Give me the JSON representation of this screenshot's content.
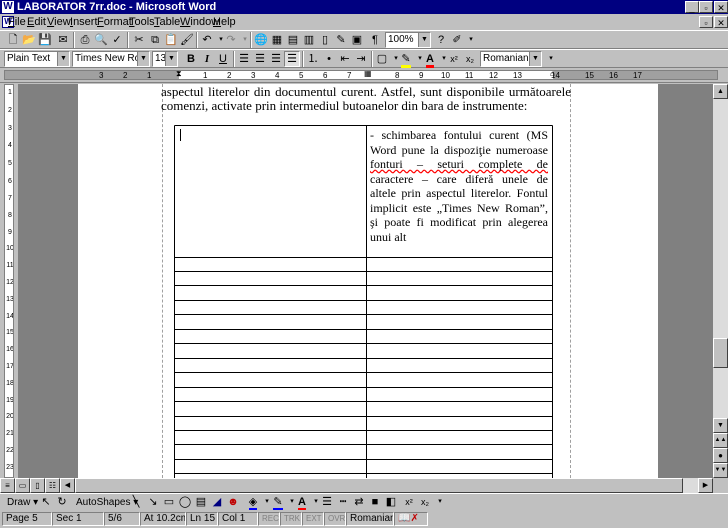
{
  "window": {
    "title": "LABORATOR 7rr.doc - Microsoft Word",
    "app_icon": "W",
    "buttons": {
      "minimize": "_",
      "restore": "▫",
      "close": "✕"
    }
  },
  "menu": {
    "items": [
      "File",
      "Edit",
      "View",
      "Insert",
      "Format",
      "Tools",
      "Table",
      "Window",
      "Help"
    ],
    "restore_icon": "▫",
    "close_icon": "✕"
  },
  "standard_toolbar": {
    "zoom": "100%"
  },
  "formatting_toolbar": {
    "style": "Plain Text",
    "font": "Times New Roman",
    "size": "13",
    "language": "Romanian (Rom"
  },
  "ruler": {
    "numbers": [
      "3",
      "2",
      "1",
      "1",
      "2",
      "3",
      "4",
      "5",
      "6",
      "7",
      "8",
      "9",
      "10",
      "11",
      "12",
      "13",
      "14",
      "15",
      "16",
      "17"
    ]
  },
  "vruler": {
    "numbers": [
      "1",
      "2",
      "3",
      "4",
      "5",
      "6",
      "7",
      "8",
      "9",
      "10",
      "11",
      "12",
      "13",
      "14",
      "15",
      "16",
      "17",
      "18",
      "19",
      "20",
      "21",
      "22",
      "23"
    ]
  },
  "document": {
    "lines": [
      "aspectul literelor din documentul curent. Astfel, sunt disponibile următoarele",
      "comenzi, activate prin intermediul butoanelor din bara de instrumente:"
    ],
    "table_cell_lines": [
      "- schimbarea fontului curent (MS",
      "Word pune la dispoziţie numeroase",
      "fonturi – seturi complete de",
      "caractere – care diferă unele de",
      "altele prin aspectul literelor. Fontul",
      "implicit este „Times New Roman”,",
      "şi poate fi modificat prin alegerea",
      "unui alt"
    ]
  },
  "draw_toolbar": {
    "draw_label": "Draw",
    "autoshapes_label": "AutoShapes"
  },
  "status": {
    "page": "Page 5",
    "section": "Sec 1",
    "pages": "5/6",
    "at": "At 10.2cm",
    "line": "Ln 15",
    "col": "Col 1",
    "rec": "REC",
    "trk": "TRK",
    "ext": "EXT",
    "ovr": "OVR",
    "language": "Romanian ("
  },
  "colors": {
    "title_bar": "#000080",
    "chrome": "#c0c0c0",
    "workspace": "#808080",
    "highlight": "#ffff00",
    "font_color": "#ff0000"
  }
}
